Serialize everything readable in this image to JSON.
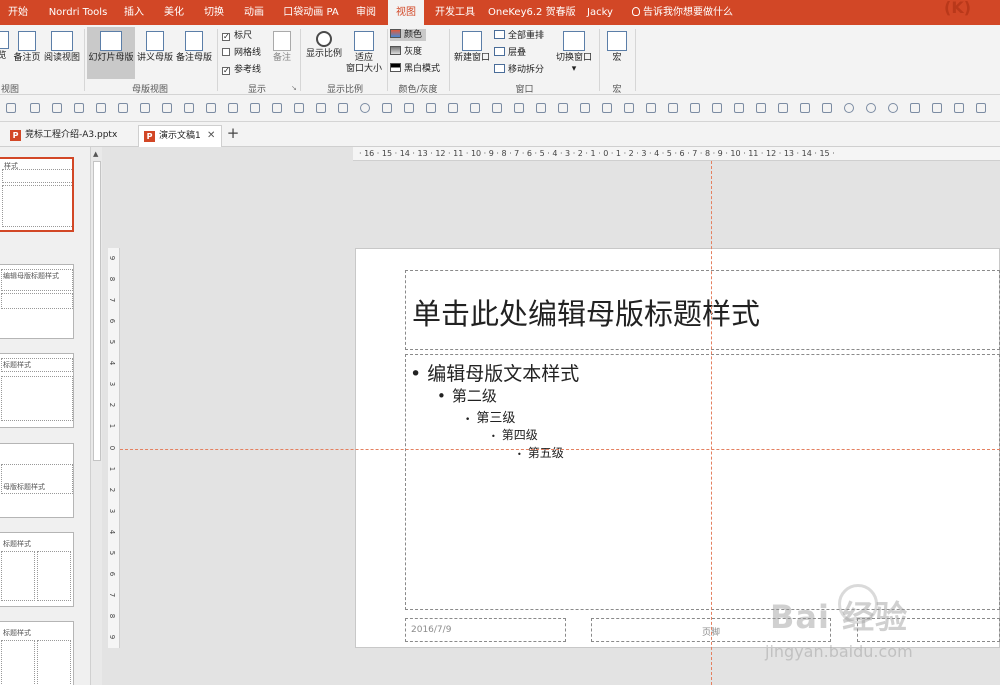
{
  "ribbon_tabs": [
    "开始",
    "Nordri Tools",
    "插入",
    "美化",
    "切换",
    "动画",
    "口袋动画 PA",
    "审阅",
    "视图",
    "开发工具",
    "OneKey6.2 贺春版",
    "Jacky"
  ],
  "active_tab": "视图",
  "tell_me": "告诉我你想要做什么",
  "views": {
    "outline": "览",
    "notes_page": "备注页",
    "reading_view": "阅读视图",
    "group_label": "视图"
  },
  "master_views": {
    "slide_master": "幻灯片母版",
    "handout_master": "讲义母版",
    "notes_master": "备注母版",
    "group_label": "母版视图"
  },
  "show": {
    "ruler": "标尺",
    "gridlines": "网格线",
    "guides": "参考线",
    "notes": "备注",
    "group_label": "显示",
    "ruler_checked": true,
    "gridlines_checked": false,
    "guides_checked": true
  },
  "zoom": {
    "zoom": "显示比例",
    "fit_line1": "适应",
    "fit_line2": "窗口大小",
    "group_label": "显示比例"
  },
  "color": {
    "color": "颜色",
    "grayscale": "灰度",
    "bw": "黑白模式",
    "group_label": "颜色/灰度"
  },
  "window": {
    "new_window": "新建窗口",
    "arrange_all": "全部重排",
    "cascade": "层叠",
    "move_split": "移动拆分",
    "switch_window": "切换窗口",
    "group_label": "窗口"
  },
  "macro": {
    "label": "宏",
    "group_label": "宏"
  },
  "doc_tabs": [
    "竞标工程介绍-A3.pptx",
    "演示文稿1"
  ],
  "thumbnails": [
    {
      "text": "样式"
    },
    {
      "text": "编辑母版标题样式"
    },
    {
      "text": "标题样式"
    },
    {
      "text": "母版标题样式"
    },
    {
      "text": "标题样式"
    },
    {
      "text": "标题样式"
    }
  ],
  "ruler": {
    "h_ticks": "· 16 · 15 · 14 · 13 · 12 · 11 · 10 · 9 · 8 · 7 · 6 · 5 · 4 · 3 · 2 · 1 · 0 · 1 · 2 · 3 · 4 · 5 · 6 · 7 · 8 · 9 · 10 · 11 · 12 · 13 · 14 · 15 ·",
    "v_ticks": [
      "9",
      "8",
      "7",
      "6",
      "5",
      "4",
      "3",
      "2",
      "1",
      "0",
      "1",
      "2",
      "3",
      "4",
      "5",
      "6",
      "7",
      "8",
      "9"
    ]
  },
  "slide": {
    "title": "单击此处编辑母版标题样式",
    "levels": [
      "编辑母版文本样式",
      "第二级",
      "第三级",
      "第四级",
      "第五级"
    ],
    "date": "2016/7/9",
    "footer": "页脚"
  },
  "watermark": {
    "line1": "Bai 经验",
    "line2": "jingyan.baidu.com"
  },
  "colors": {
    "accent": "#d24726",
    "guide": "#e48060"
  }
}
